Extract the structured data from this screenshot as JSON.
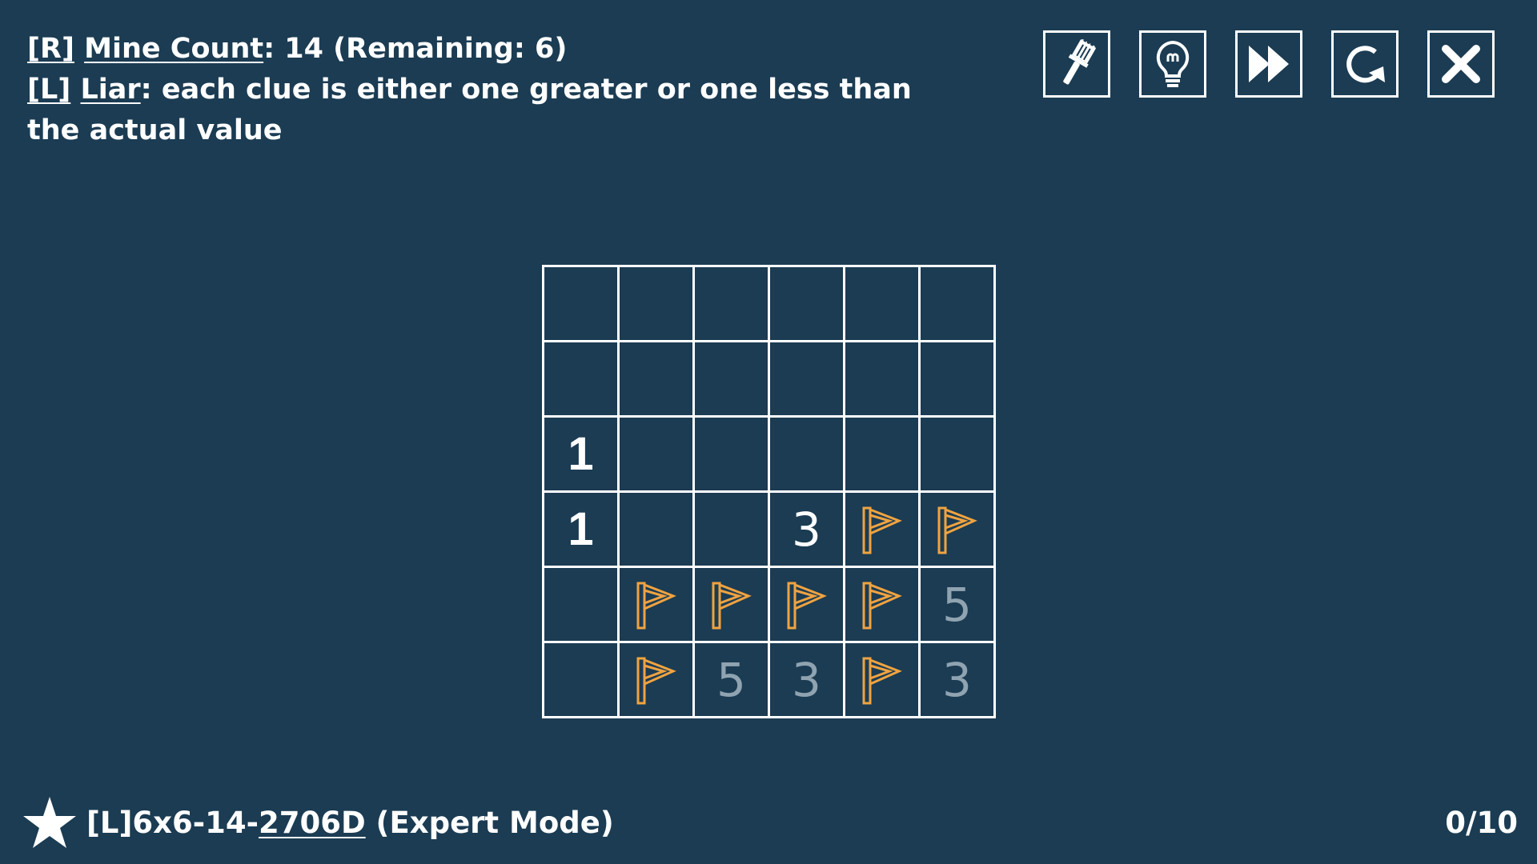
{
  "rules": {
    "line1_key": "[R]",
    "line1_name": "Mine Count",
    "line1_value": ":  14 (Remaining: 6)",
    "line2_key": "[L]",
    "line2_name": "Liar",
    "line2_text": ": each clue is either one greater or one less than the actual value"
  },
  "toolbar": [
    {
      "icon": "brush-icon",
      "name": "brush-button"
    },
    {
      "icon": "lightbulb-icon",
      "name": "hint-button"
    },
    {
      "icon": "fast-forward-icon",
      "name": "skip-button"
    },
    {
      "icon": "restart-icon",
      "name": "restart-button"
    },
    {
      "icon": "close-icon",
      "name": "close-button"
    }
  ],
  "board": {
    "rows": 6,
    "cols": 6,
    "cells": [
      [
        "",
        "",
        "",
        "",
        "",
        ""
      ],
      [
        "",
        "",
        "",
        "",
        "",
        ""
      ],
      [
        "1",
        "",
        "",
        "",
        "",
        ""
      ],
      [
        "1",
        "",
        "",
        "3",
        "F",
        "F"
      ],
      [
        "",
        "F",
        "F",
        "F",
        "F",
        "5d"
      ],
      [
        "",
        "F",
        "5d",
        "3d",
        "F",
        "3d"
      ]
    ]
  },
  "colors": {
    "background": "#1b3c53",
    "flag": "#f0a340",
    "dim_number": "#8fa3b1",
    "line": "#ffffff"
  },
  "footer": {
    "level_prefix": "[L]6x6-14-",
    "level_code": "2706D",
    "level_suffix": " (Expert Mode)",
    "progress": "0/10"
  }
}
